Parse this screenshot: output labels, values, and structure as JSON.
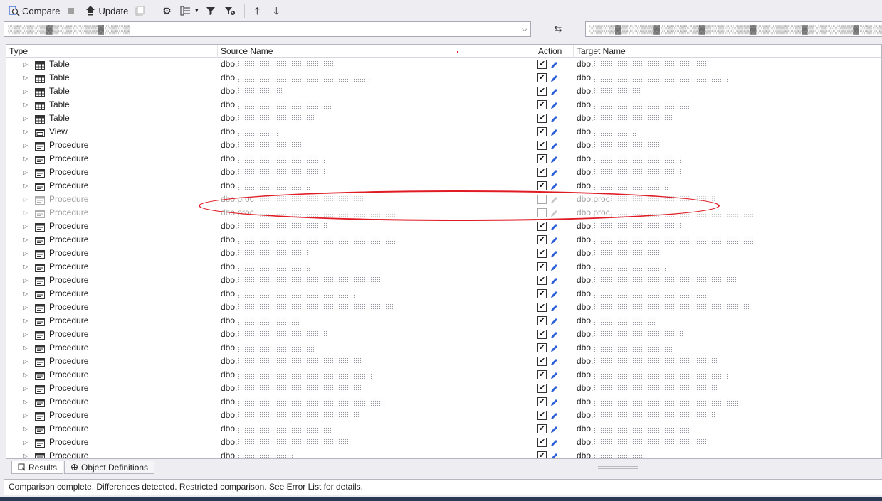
{
  "toolbar": {
    "compare_label": "Compare",
    "update_label": "Update"
  },
  "source_combo": {
    "value": "░▒░▒░▒▓▒░▒░░▒▒▓░▒░▒"
  },
  "target_combo": {
    "value": "░▒░▒▓▒░░▒▒▓░▒░▒░▒▓▒░▒░░▒▒▓░▒░▒▒░▒▓▒░▒░░▒▒▓░▒░▒"
  },
  "grid": {
    "columns": [
      "Type",
      "Source Name",
      "Action",
      "Target Name"
    ],
    "rows": [
      {
        "type": "Table",
        "prefix": "dbo.",
        "src_w": 137,
        "tgt_w": 160,
        "checked": true,
        "enabled": true,
        "icon": "table"
      },
      {
        "type": "Table",
        "prefix": "dbo.",
        "src_w": 187,
        "tgt_w": 190,
        "checked": true,
        "enabled": true,
        "icon": "table"
      },
      {
        "type": "Table",
        "prefix": "dbo.",
        "src_w": 64,
        "tgt_w": 66,
        "checked": true,
        "enabled": true,
        "icon": "table"
      },
      {
        "type": "Table",
        "prefix": "dbo.",
        "src_w": 132,
        "tgt_w": 134,
        "checked": true,
        "enabled": true,
        "icon": "table"
      },
      {
        "type": "Table",
        "prefix": "dbo.",
        "src_w": 107,
        "tgt_w": 112,
        "checked": true,
        "enabled": true,
        "icon": "table"
      },
      {
        "type": "View",
        "prefix": "dbo.",
        "src_w": 58,
        "tgt_w": 60,
        "checked": true,
        "enabled": true,
        "icon": "view"
      },
      {
        "type": "Procedure",
        "prefix": "dbo.",
        "src_w": 92,
        "tgt_w": 92,
        "checked": true,
        "enabled": true,
        "icon": "proc"
      },
      {
        "type": "Procedure",
        "prefix": "dbo.",
        "src_w": 122,
        "tgt_w": 124,
        "checked": true,
        "enabled": true,
        "icon": "proc"
      },
      {
        "type": "Procedure",
        "prefix": "dbo.",
        "src_w": 122,
        "tgt_w": 124,
        "checked": true,
        "enabled": true,
        "icon": "proc"
      },
      {
        "type": "Procedure",
        "prefix": "dbo.",
        "src_w": 102,
        "tgt_w": 104,
        "checked": true,
        "enabled": true,
        "icon": "proc"
      },
      {
        "type": "Procedure",
        "prefix": "dbo.proc",
        "src_w": 154,
        "tgt_w": 146,
        "checked": false,
        "enabled": false,
        "icon": "proc"
      },
      {
        "type": "Procedure",
        "prefix": "dbo.proc",
        "src_w": 198,
        "tgt_w": 200,
        "checked": false,
        "enabled": false,
        "icon": "proc"
      },
      {
        "type": "Procedure",
        "prefix": "dbo.",
        "src_w": 126,
        "tgt_w": 124,
        "checked": true,
        "enabled": true,
        "icon": "proc"
      },
      {
        "type": "Procedure",
        "prefix": "dbo.",
        "src_w": 222,
        "tgt_w": 224,
        "checked": true,
        "enabled": true,
        "icon": "proc"
      },
      {
        "type": "Procedure",
        "prefix": "dbo.",
        "src_w": 100,
        "tgt_w": 98,
        "checked": true,
        "enabled": true,
        "icon": "proc"
      },
      {
        "type": "Procedure",
        "prefix": "dbo.",
        "src_w": 102,
        "tgt_w": 102,
        "checked": true,
        "enabled": true,
        "icon": "proc"
      },
      {
        "type": "Procedure",
        "prefix": "dbo.",
        "src_w": 200,
        "tgt_w": 202,
        "checked": true,
        "enabled": true,
        "icon": "proc"
      },
      {
        "type": "Procedure",
        "prefix": "dbo.",
        "src_w": 166,
        "tgt_w": 166,
        "checked": true,
        "enabled": true,
        "icon": "proc"
      },
      {
        "type": "Procedure",
        "prefix": "dbo.",
        "src_w": 218,
        "tgt_w": 220,
        "checked": true,
        "enabled": true,
        "icon": "proc"
      },
      {
        "type": "Procedure",
        "prefix": "dbo.",
        "src_w": 88,
        "tgt_w": 88,
        "checked": true,
        "enabled": true,
        "icon": "proc"
      },
      {
        "type": "Procedure",
        "prefix": "dbo.",
        "src_w": 126,
        "tgt_w": 126,
        "checked": true,
        "enabled": true,
        "icon": "proc"
      },
      {
        "type": "Procedure",
        "prefix": "dbo.",
        "src_w": 108,
        "tgt_w": 110,
        "checked": true,
        "enabled": true,
        "icon": "proc"
      },
      {
        "type": "Procedure",
        "prefix": "dbo.",
        "src_w": 174,
        "tgt_w": 174,
        "checked": true,
        "enabled": true,
        "icon": "proc"
      },
      {
        "type": "Procedure",
        "prefix": "dbo.",
        "src_w": 190,
        "tgt_w": 190,
        "checked": true,
        "enabled": true,
        "icon": "proc"
      },
      {
        "type": "Procedure",
        "prefix": "dbo.",
        "src_w": 174,
        "tgt_w": 174,
        "checked": true,
        "enabled": true,
        "icon": "proc"
      },
      {
        "type": "Procedure",
        "prefix": "dbo.",
        "src_w": 208,
        "tgt_w": 208,
        "checked": true,
        "enabled": true,
        "icon": "proc"
      },
      {
        "type": "Procedure",
        "prefix": "dbo.",
        "src_w": 172,
        "tgt_w": 172,
        "checked": true,
        "enabled": true,
        "icon": "proc"
      },
      {
        "type": "Procedure",
        "prefix": "dbo.",
        "src_w": 132,
        "tgt_w": 134,
        "checked": true,
        "enabled": true,
        "icon": "proc"
      },
      {
        "type": "Procedure",
        "prefix": "dbo.",
        "src_w": 162,
        "tgt_w": 162,
        "checked": true,
        "enabled": true,
        "icon": "proc"
      },
      {
        "type": "Procedure",
        "prefix": "dbo.",
        "src_w": 78,
        "tgt_w": 74,
        "checked": true,
        "enabled": true,
        "icon": "proc"
      }
    ]
  },
  "tabs": [
    {
      "label": "Results",
      "icon": "results-icon"
    },
    {
      "label": "Object Definitions",
      "icon": "object-definitions-icon"
    }
  ],
  "status": {
    "text": "Comparison complete.  Differences detected. Restricted comparison. See Error List for details."
  },
  "colors": {
    "annotation": "#e01b24",
    "edit_pencil": "#2b5fd9"
  }
}
